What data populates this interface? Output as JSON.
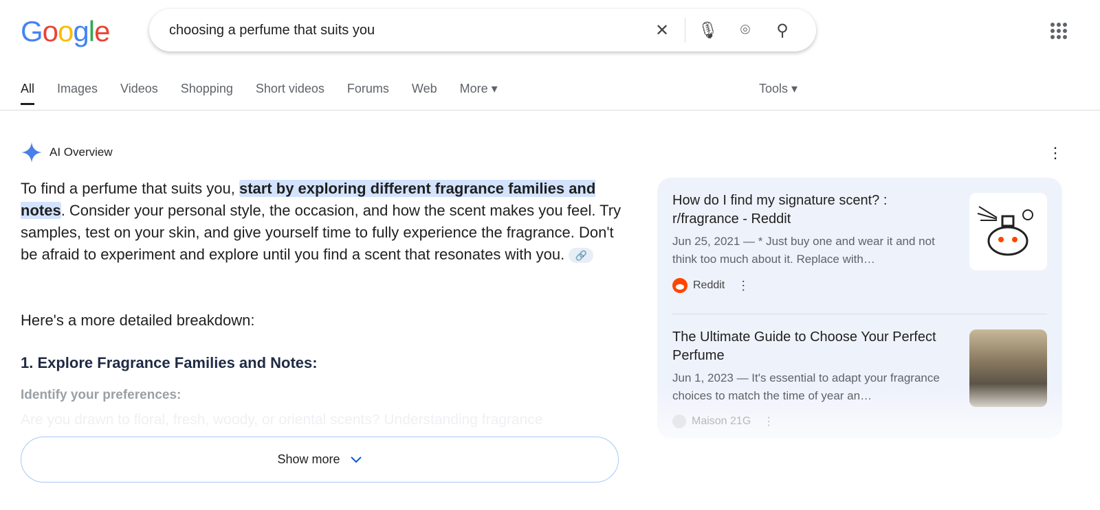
{
  "logo": "Google",
  "search": {
    "query": "choosing a perfume that suits you"
  },
  "tabs": [
    "All",
    "Images",
    "Videos",
    "Shopping",
    "Short videos",
    "Forums",
    "Web",
    "More ▾"
  ],
  "tools": "Tools ▾",
  "ai": {
    "title": "AI Overview",
    "p1_a": "To find a perfume that suits you, ",
    "p1_hl": "start by exploring different fragrance families and notes",
    "p1_b": ". Consider your personal style, the occasion, and how the scent makes you feel. Try samples, test on your skin, and give yourself time to fully experience the fragrance. Don't be afraid to experiment and explore until you find a scent that resonates with you.",
    "p2": "Here's a more detailed breakdown:",
    "h1": "1. Explore Fragrance Families and Notes:",
    "h2": "Identify your preferences:",
    "p3": "Are you drawn to floral, fresh, woody, or oriental scents? Understanding fragrance",
    "show_more": "Show more"
  },
  "sources": [
    {
      "title": "How do I find my signature scent? : r/fragrance - Reddit",
      "snippet": "Jun 25, 2021 — * Just buy one and wear it and not think too much about it. Replace with…",
      "site": "Reddit"
    },
    {
      "title": "The Ultimate Guide to Choose Your Perfect Perfume",
      "snippet": "Jun 1, 2023 — It's essential to adapt your fragrance choices to match the time of year an…",
      "site": "Maison 21G"
    }
  ]
}
